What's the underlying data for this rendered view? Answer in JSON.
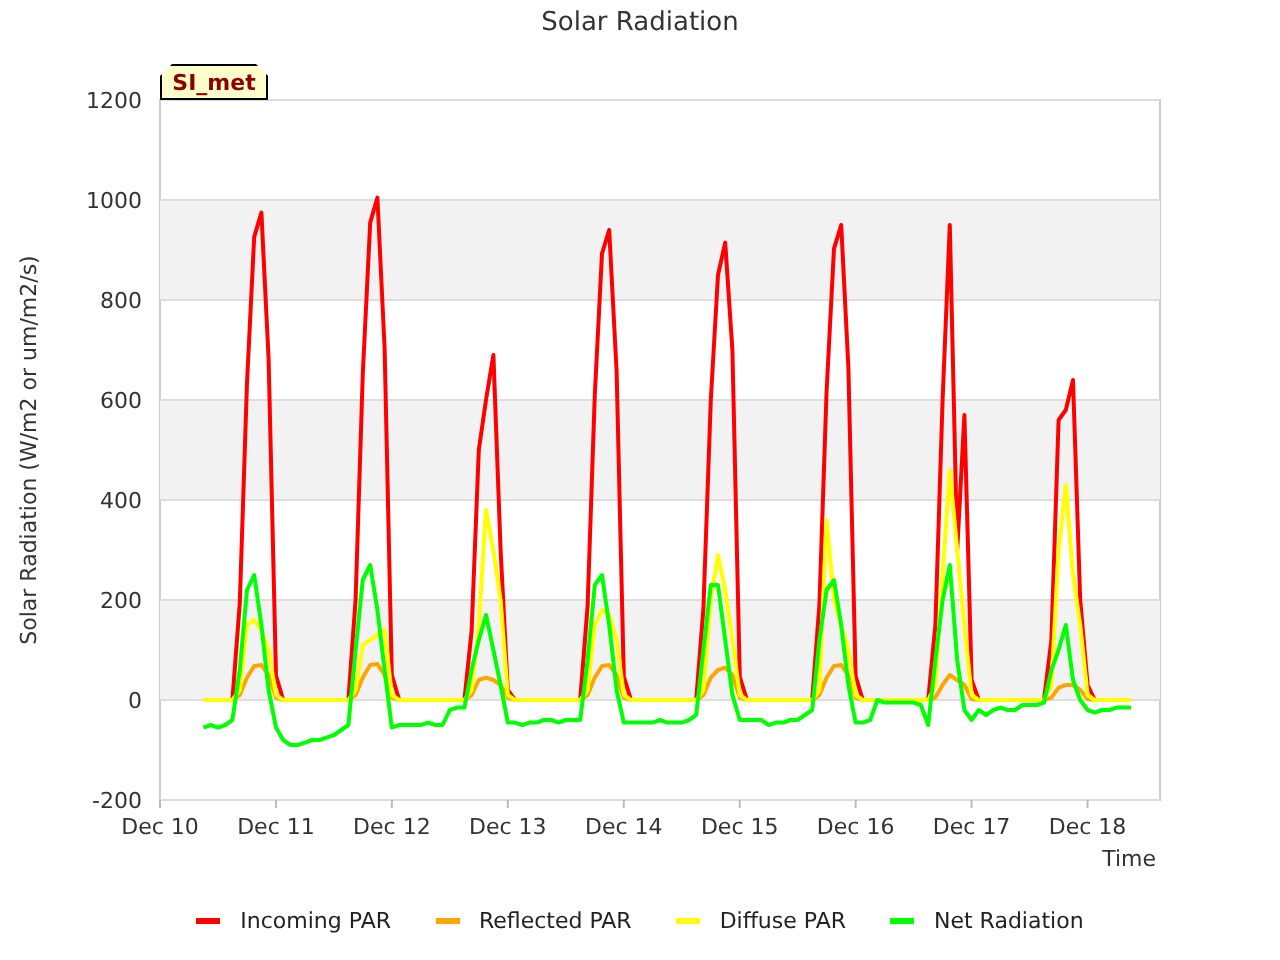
{
  "badge": "SI_met",
  "chart_data": {
    "type": "line",
    "title": "Solar Radiation",
    "xlabel": "Time",
    "ylabel": "Solar Radiation (W/m2 or um/m2/s)",
    "ylim": [
      -200,
      1200
    ],
    "grid": true,
    "legend": true,
    "yticks": [
      -200,
      0,
      200,
      400,
      600,
      800,
      1000,
      1200
    ],
    "categories": [
      "Dec 10",
      null,
      null,
      null,
      null,
      null,
      null,
      null,
      null,
      null,
      null,
      null,
      null,
      null,
      null,
      null,
      "Dec 11",
      null,
      null,
      null,
      null,
      null,
      null,
      null,
      null,
      null,
      null,
      null,
      null,
      null,
      null,
      null,
      "Dec 12",
      null,
      null,
      null,
      null,
      null,
      null,
      null,
      null,
      null,
      null,
      null,
      null,
      null,
      null,
      null,
      "Dec 13",
      null,
      null,
      null,
      null,
      null,
      null,
      null,
      null,
      null,
      null,
      null,
      null,
      null,
      null,
      null,
      "Dec 14",
      null,
      null,
      null,
      null,
      null,
      null,
      null,
      null,
      null,
      null,
      null,
      null,
      null,
      null,
      null,
      "Dec 15",
      null,
      null,
      null,
      null,
      null,
      null,
      null,
      null,
      null,
      null,
      null,
      null,
      null,
      null,
      null,
      "Dec 16",
      null,
      null,
      null,
      null,
      null,
      null,
      null,
      null,
      null,
      null,
      null,
      null,
      null,
      null,
      null,
      "Dec 17",
      null,
      null,
      null,
      null,
      null,
      null,
      null,
      null,
      null,
      null,
      null,
      null,
      null,
      null,
      null,
      "Dec 18",
      null,
      null,
      null,
      null,
      null,
      null,
      null,
      null,
      null,
      null
    ],
    "series": [
      {
        "name": "Incoming PAR",
        "color": "#ff0000",
        "values": [
          null,
          null,
          null,
          null,
          null,
          null,
          null,
          null,
          0,
          0,
          0,
          195,
          634,
          926,
          975,
          683,
          49,
          0,
          0,
          0,
          0,
          0,
          0,
          0,
          0,
          0,
          0,
          201,
          653,
          955,
          1005,
          704,
          50,
          0,
          0,
          0,
          0,
          0,
          0,
          0,
          0,
          0,
          0,
          138,
          500,
          600,
          690,
          300,
          20,
          0,
          0,
          0,
          0,
          0,
          0,
          0,
          0,
          0,
          0,
          188,
          611,
          893,
          940,
          658,
          47,
          0,
          0,
          0,
          0,
          0,
          0,
          0,
          0,
          0,
          0,
          183,
          600,
          850,
          915,
          700,
          46,
          0,
          0,
          0,
          0,
          0,
          0,
          0,
          0,
          0,
          0,
          190,
          618,
          903,
          950,
          665,
          48,
          0,
          0,
          0,
          0,
          0,
          0,
          0,
          0,
          0,
          0,
          150,
          600,
          950,
          300,
          570,
          40,
          0,
          0,
          0,
          0,
          0,
          0,
          0,
          0,
          0,
          0,
          120,
          560,
          580,
          640,
          200,
          30,
          0,
          0,
          0,
          null,
          null,
          null,
          null,
          null,
          null,
          null
        ]
      },
      {
        "name": "Reflected PAR",
        "color": "#ffa500",
        "values": [
          null,
          null,
          null,
          null,
          null,
          null,
          null,
          null,
          0,
          0,
          0,
          10,
          45,
          68,
          70,
          50,
          5,
          0,
          0,
          0,
          0,
          0,
          0,
          0,
          0,
          0,
          0,
          10,
          45,
          70,
          72,
          50,
          5,
          0,
          0,
          0,
          0,
          0,
          0,
          0,
          0,
          0,
          0,
          10,
          40,
          45,
          40,
          30,
          5,
          0,
          0,
          0,
          0,
          0,
          0,
          0,
          0,
          0,
          0,
          10,
          45,
          68,
          70,
          50,
          5,
          0,
          0,
          0,
          0,
          0,
          0,
          0,
          0,
          0,
          0,
          10,
          45,
          60,
          65,
          50,
          5,
          0,
          0,
          0,
          0,
          0,
          0,
          0,
          0,
          0,
          0,
          10,
          45,
          68,
          70,
          50,
          5,
          0,
          0,
          0,
          0,
          0,
          0,
          0,
          0,
          0,
          0,
          5,
          30,
          50,
          40,
          30,
          2,
          0,
          0,
          0,
          0,
          0,
          0,
          0,
          0,
          0,
          0,
          5,
          25,
          30,
          30,
          20,
          2,
          0,
          0,
          0,
          null,
          null,
          null,
          null,
          null,
          null,
          null
        ]
      },
      {
        "name": "Diffuse PAR",
        "color": "#ffff00",
        "values": [
          null,
          null,
          null,
          null,
          null,
          null,
          0,
          0,
          0,
          0,
          0,
          20,
          150,
          160,
          140,
          100,
          10,
          0,
          0,
          0,
          0,
          0,
          0,
          0,
          0,
          0,
          0,
          20,
          110,
          120,
          130,
          140,
          10,
          0,
          0,
          0,
          0,
          0,
          0,
          0,
          0,
          0,
          0,
          20,
          150,
          380,
          300,
          200,
          10,
          0,
          0,
          0,
          0,
          0,
          0,
          0,
          0,
          0,
          0,
          20,
          150,
          180,
          170,
          120,
          10,
          0,
          0,
          0,
          0,
          0,
          0,
          0,
          0,
          0,
          0,
          20,
          200,
          290,
          220,
          120,
          10,
          0,
          0,
          0,
          0,
          0,
          0,
          0,
          0,
          0,
          0,
          20,
          360,
          200,
          150,
          100,
          10,
          0,
          0,
          0,
          0,
          0,
          0,
          0,
          0,
          0,
          0,
          30,
          250,
          460,
          300,
          150,
          10,
          0,
          0,
          0,
          0,
          0,
          0,
          0,
          0,
          0,
          0,
          30,
          300,
          430,
          250,
          150,
          10,
          0,
          0,
          0,
          0,
          0,
          0,
          null,
          null,
          null,
          null
        ]
      },
      {
        "name": "Net Radiation",
        "color": "#00ff00",
        "values": [
          null,
          null,
          null,
          null,
          null,
          null,
          -55,
          -50,
          -55,
          -50,
          -40,
          60,
          220,
          250,
          150,
          20,
          -55,
          -80,
          -90,
          -90,
          -85,
          -80,
          -80,
          -75,
          -70,
          -60,
          -50,
          100,
          240,
          270,
          180,
          60,
          -55,
          -50,
          -50,
          -50,
          -50,
          -45,
          -50,
          -50,
          -20,
          -15,
          -15,
          60,
          120,
          170,
          100,
          30,
          -45,
          -45,
          -50,
          -45,
          -45,
          -40,
          -40,
          -45,
          -40,
          -40,
          -40,
          80,
          230,
          250,
          150,
          20,
          -45,
          -45,
          -45,
          -45,
          -45,
          -40,
          -45,
          -45,
          -45,
          -40,
          -30,
          100,
          230,
          230,
          120,
          10,
          -40,
          -40,
          -40,
          -40,
          -50,
          -45,
          -45,
          -40,
          -40,
          -30,
          -20,
          120,
          220,
          240,
          150,
          30,
          -45,
          -45,
          -40,
          0,
          -5,
          -5,
          -5,
          -5,
          -5,
          -10,
          -50,
          80,
          200,
          270,
          80,
          -20,
          -40,
          -20,
          -30,
          -20,
          -15,
          -20,
          -20,
          -10,
          -10,
          -10,
          -5,
          60,
          100,
          150,
          40,
          0,
          -20,
          -25,
          -20,
          -20,
          -15,
          -15,
          -15,
          null,
          null,
          null,
          null
        ]
      }
    ]
  }
}
